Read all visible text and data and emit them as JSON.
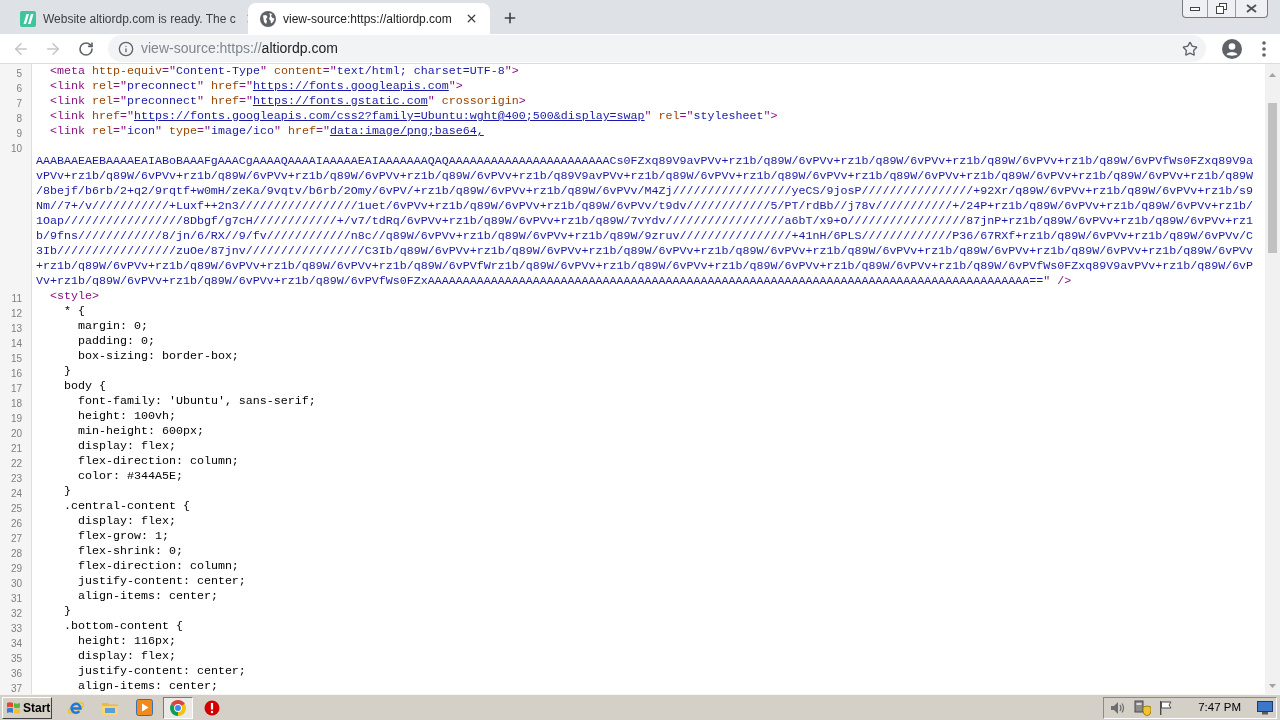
{
  "tabs": [
    {
      "title": "Website altiordp.com is ready. The c",
      "kind": "logo",
      "selected": false
    },
    {
      "title": "view-source:https://altiordp.com",
      "kind": "globe",
      "selected": true
    }
  ],
  "toolbar": {
    "back": {
      "disabled": true
    },
    "forward": {
      "disabled": true
    },
    "url_scheme": "view-source:https://",
    "url_host": "altiordp.com"
  },
  "source": {
    "lines": [
      {
        "number": "5",
        "tokens": [
          {
            "kind": "tag",
            "text": "  <meta "
          },
          {
            "kind": "attr",
            "text": "http-equiv"
          },
          {
            "kind": "tag",
            "text": "=\""
          },
          {
            "kind": "value",
            "text": "Content-Type"
          },
          {
            "kind": "tag",
            "text": "\" "
          },
          {
            "kind": "attr",
            "text": "content"
          },
          {
            "kind": "tag",
            "text": "=\""
          },
          {
            "kind": "value",
            "text": "text/html; charset=UTF-8"
          },
          {
            "kind": "tag",
            "text": "\">"
          }
        ]
      },
      {
        "number": "6",
        "tokens": [
          {
            "kind": "tag",
            "text": "  <link "
          },
          {
            "kind": "attr",
            "text": "rel"
          },
          {
            "kind": "tag",
            "text": "=\""
          },
          {
            "kind": "value",
            "text": "preconnect"
          },
          {
            "kind": "tag",
            "text": "\" "
          },
          {
            "kind": "attr",
            "text": "href"
          },
          {
            "kind": "tag",
            "text": "=\""
          },
          {
            "kind": "link",
            "text": "https://fonts.googleapis.com"
          },
          {
            "kind": "tag",
            "text": "\">"
          }
        ]
      },
      {
        "number": "7",
        "tokens": [
          {
            "kind": "tag",
            "text": "  <link "
          },
          {
            "kind": "attr",
            "text": "rel"
          },
          {
            "kind": "tag",
            "text": "=\""
          },
          {
            "kind": "value",
            "text": "preconnect"
          },
          {
            "kind": "tag",
            "text": "\" "
          },
          {
            "kind": "attr",
            "text": "href"
          },
          {
            "kind": "tag",
            "text": "=\""
          },
          {
            "kind": "link",
            "text": "https://fonts.gstatic.com"
          },
          {
            "kind": "tag",
            "text": "\" "
          },
          {
            "kind": "attr",
            "text": "crossorigin"
          },
          {
            "kind": "tag",
            "text": ">"
          }
        ]
      },
      {
        "number": "8",
        "tokens": [
          {
            "kind": "tag",
            "text": "  <link "
          },
          {
            "kind": "attr",
            "text": "href"
          },
          {
            "kind": "tag",
            "text": "=\""
          },
          {
            "kind": "link",
            "text": "https://fonts.googleapis.com/css2?family=Ubuntu:wght@400;500&display=swap"
          },
          {
            "kind": "tag",
            "text": "\" "
          },
          {
            "kind": "attr",
            "text": "rel"
          },
          {
            "kind": "tag",
            "text": "=\""
          },
          {
            "kind": "value",
            "text": "stylesheet"
          },
          {
            "kind": "tag",
            "text": "\">"
          }
        ]
      },
      {
        "number": "9",
        "tokens": [
          {
            "kind": "tag",
            "text": "  <link "
          },
          {
            "kind": "attr",
            "text": "rel"
          },
          {
            "kind": "tag",
            "text": "=\""
          },
          {
            "kind": "value",
            "text": "icon"
          },
          {
            "kind": "tag",
            "text": "\" "
          },
          {
            "kind": "attr",
            "text": "type"
          },
          {
            "kind": "tag",
            "text": "=\""
          },
          {
            "kind": "value",
            "text": "image/ico"
          },
          {
            "kind": "tag",
            "text": "\" "
          },
          {
            "kind": "attr",
            "text": "href"
          },
          {
            "kind": "tag",
            "text": "=\""
          },
          {
            "kind": "link",
            "text": "data:image/png;base64,"
          }
        ]
      },
      {
        "number": "10"
      },
      {
        "tokens": [
          {
            "kind": "value",
            "text": "AAABAAEAEBAAAAEAIABoBAAAFgAAACgAAAAQAAAAIAAAAAEAIAAAAAAAQAQAAAAAAAAAAAAAAAAAAAAAAACs0FZxq89V9avPVv+rz1b/q89W/6vPVv+rz1b/q89W/6vPVv+rz1b/q89W/6vPVv+rz1b/q89W/6vPVfWs0FZxq89V9a"
          }
        ]
      },
      {
        "tokens": [
          {
            "kind": "value",
            "text": "vPVv+rz1b/q89W/6vPVv+rz1b/q89W/6vPVv+rz1b/q89W/6vPVv+rz1b/q89W/6vPVv+rz1b/q89V9avPVv+rz1b/q89W/6vPVv+rz1b/q89W/6vPVv+rz1b/q89W/6vPVv+rz1b/q89W/6vPVv+rz1b/q89W/6vPVv+rz1b/q89W"
          }
        ]
      },
      {
        "tokens": [
          {
            "kind": "value",
            "text": "/8bejf/b6rb/2+q2/9rqtf+w0mH/zeKa/9vqtv/b6rb/2Omy/6vPV/+rz1b/q89W/6vPVv+rz1b/q89W/6vPVv/M4Zj/////////////////yeCS/9josP////////////////+92Xr/q89W/6vPVv+rz1b/q89W/6vPVv+rz1b/s9"
          }
        ]
      },
      {
        "tokens": [
          {
            "kind": "value",
            "text": "Nm//7+/v///////////+Luxf++2n3/////////////////1uet/6vPVv+rz1b/q89W/6vPVv+rz1b/q89W/6vPVv/t9dv////////////5/PT/rdBb//j78v///////////+/24P+rz1b/q89W/6vPVv+rz1b/q89W/6vPVv+rz1b/"
          }
        ]
      },
      {
        "tokens": [
          {
            "kind": "value",
            "text": "1Oap/////////////////8Dbgf/g7cH////////////+/v7/tdRq/6vPVv+rz1b/q89W/6vPVv+rz1b/q89W/7vYdv/////////////////a6bT/x9+O/////////////////87jnP+rz1b/q89W/6vPVv+rz1b/q89W/6vPVv+rz1"
          }
        ]
      },
      {
        "tokens": [
          {
            "kind": "value",
            "text": "b/9fns////////////8/jn/6/RX//9/fv////////////n8c//q89W/6vPVv+rz1b/q89W/6vPVv+rz1b/q89W/9zruv////////////////+41nH/6PLS/////////////P36/67RXf+rz1b/q89W/6vPVv+rz1b/q89W/6vPVv/C"
          }
        ]
      },
      {
        "tokens": [
          {
            "kind": "value",
            "text": "3Ib/////////////////zuOe/87jnv/////////////////C3Ib/q89W/6vPVv+rz1b/q89W/6vPVv+rz1b/q89W/6vPVv+rz1b/q89W/6vPVv+rz1b/q89W/6vPVv+rz1b/q89W/6vPVv+rz1b/q89W/6vPVv+rz1b/q89W/6vPVv"
          }
        ]
      },
      {
        "tokens": [
          {
            "kind": "value",
            "text": "+rz1b/q89W/6vPVv+rz1b/q89W/6vPVv+rz1b/q89W/6vPVv+rz1b/q89W/6vPVfWrz1b/q89W/6vPVv+rz1b/q89W/6vPVv+rz1b/q89W/6vPVv+rz1b/q89W/6vPVv+rz1b/q89W/6vPVfWs0FZxq89V9avPVv+rz1b/q89W/6vP"
          }
        ]
      },
      {
        "tokens": [
          {
            "kind": "value",
            "text": "Vv+rz1b/q89W/6vPVv+rz1b/q89W/6vPVv+rz1b/q89W/6vPVfWs0FZxAAAAAAAAAAAAAAAAAAAAAAAAAAAAAAAAAAAAAAAAAAAAAAAAAAAAAAAAAAAAAAAAAAAAAAAAAAAAAAAAAAAAAA=="
          },
          {
            "kind": "tag",
            "text": "\" />"
          }
        ]
      },
      {
        "number": "11",
        "tokens": [
          {
            "kind": "tag",
            "text": "  <style>"
          }
        ]
      },
      {
        "number": "12",
        "tokens": [
          {
            "kind": "text",
            "text": "    * {"
          }
        ]
      },
      {
        "number": "13",
        "tokens": [
          {
            "kind": "text",
            "text": "      margin: 0;"
          }
        ]
      },
      {
        "number": "14",
        "tokens": [
          {
            "kind": "text",
            "text": "      padding: 0;"
          }
        ]
      },
      {
        "number": "15",
        "tokens": [
          {
            "kind": "text",
            "text": "      box-sizing: border-box;"
          }
        ]
      },
      {
        "number": "16",
        "tokens": [
          {
            "kind": "text",
            "text": "    }"
          }
        ]
      },
      {
        "number": "17",
        "tokens": [
          {
            "kind": "text",
            "text": "    body {"
          }
        ]
      },
      {
        "number": "18",
        "tokens": [
          {
            "kind": "text",
            "text": "      font-family: 'Ubuntu', sans-serif;"
          }
        ]
      },
      {
        "number": "19",
        "tokens": [
          {
            "kind": "text",
            "text": "      height: 100vh;"
          }
        ]
      },
      {
        "number": "20",
        "tokens": [
          {
            "kind": "text",
            "text": "      min-height: 600px;"
          }
        ]
      },
      {
        "number": "21",
        "tokens": [
          {
            "kind": "text",
            "text": "      display: flex;"
          }
        ]
      },
      {
        "number": "22",
        "tokens": [
          {
            "kind": "text",
            "text": "      flex-direction: column;"
          }
        ]
      },
      {
        "number": "23",
        "tokens": [
          {
            "kind": "text",
            "text": "      color: #344A5E;"
          }
        ]
      },
      {
        "number": "24",
        "tokens": [
          {
            "kind": "text",
            "text": "    }"
          }
        ]
      },
      {
        "number": "25",
        "tokens": [
          {
            "kind": "text",
            "text": "    .central-content {"
          }
        ]
      },
      {
        "number": "26",
        "tokens": [
          {
            "kind": "text",
            "text": "      display: flex;"
          }
        ]
      },
      {
        "number": "27",
        "tokens": [
          {
            "kind": "text",
            "text": "      flex-grow: 1;"
          }
        ]
      },
      {
        "number": "28",
        "tokens": [
          {
            "kind": "text",
            "text": "      flex-shrink: 0;"
          }
        ]
      },
      {
        "number": "29",
        "tokens": [
          {
            "kind": "text",
            "text": "      flex-direction: column;"
          }
        ]
      },
      {
        "number": "30",
        "tokens": [
          {
            "kind": "text",
            "text": "      justify-content: center;"
          }
        ]
      },
      {
        "number": "31",
        "tokens": [
          {
            "kind": "text",
            "text": "      align-items: center;"
          }
        ]
      },
      {
        "number": "32",
        "tokens": [
          {
            "kind": "text",
            "text": "    }"
          }
        ]
      },
      {
        "number": "33",
        "tokens": [
          {
            "kind": "text",
            "text": "    .bottom-content {"
          }
        ]
      },
      {
        "number": "34",
        "tokens": [
          {
            "kind": "text",
            "text": "      height: 116px;"
          }
        ]
      },
      {
        "number": "35",
        "tokens": [
          {
            "kind": "text",
            "text": "      display: flex;"
          }
        ]
      },
      {
        "number": "36",
        "tokens": [
          {
            "kind": "text",
            "text": "      justify-content: center;"
          }
        ]
      },
      {
        "number": "37",
        "tokens": [
          {
            "kind": "text",
            "text": "      align-items: center;"
          }
        ]
      }
    ]
  },
  "taskbar": {
    "start": "Start",
    "apps": [
      {
        "kind": "ebrowser",
        "selected": false
      },
      {
        "kind": "folder",
        "selected": false
      },
      {
        "kind": "media",
        "selected": false
      },
      {
        "kind": "chrome",
        "selected": true
      },
      {
        "kind": "alert",
        "selected": false
      }
    ],
    "clock": "7:47 PM"
  }
}
